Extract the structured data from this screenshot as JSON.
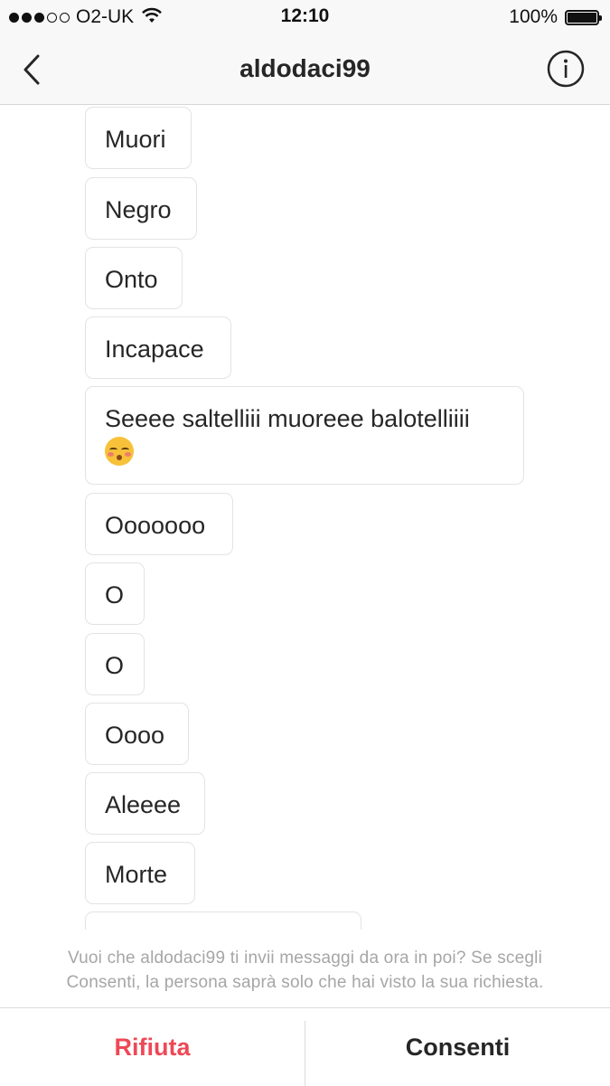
{
  "status_bar": {
    "carrier": "O2-UK",
    "signal_bars_filled": 3,
    "signal_bars_total": 5,
    "time": "12:10",
    "battery_percent": "100%"
  },
  "header": {
    "back_icon": "chevron-left-icon",
    "title": "aldodaci99",
    "info_icon": "info-circle-icon"
  },
  "messages": [
    {
      "text": "Muori"
    },
    {
      "text": "Negro"
    },
    {
      "text": "Onto"
    },
    {
      "text": "Incapace"
    },
    {
      "text": "Seeee saltelliii muoreee balotelliiii",
      "emoji": "kissing-face-with-closed-eyes-emoji"
    },
    {
      "text": "Ooooooo"
    },
    {
      "text": "O"
    },
    {
      "text": "O"
    },
    {
      "text": "Oooo"
    },
    {
      "text": "Aleeee"
    },
    {
      "text": "Morte"
    },
    {
      "text": ""
    }
  ],
  "request": {
    "notice_line1": "Vuoi che aldodaci99 ti invii messaggi da ora in poi? Se scegli",
    "notice_line2": "Consenti, la persona saprà solo che hai visto la sua richiesta.",
    "decline_label": "Rifiuta",
    "allow_label": "Consenti"
  },
  "colors": {
    "decline": "#ed4956",
    "bubble_border": "#e3e3e3",
    "notice_text": "#a6a6a6"
  }
}
